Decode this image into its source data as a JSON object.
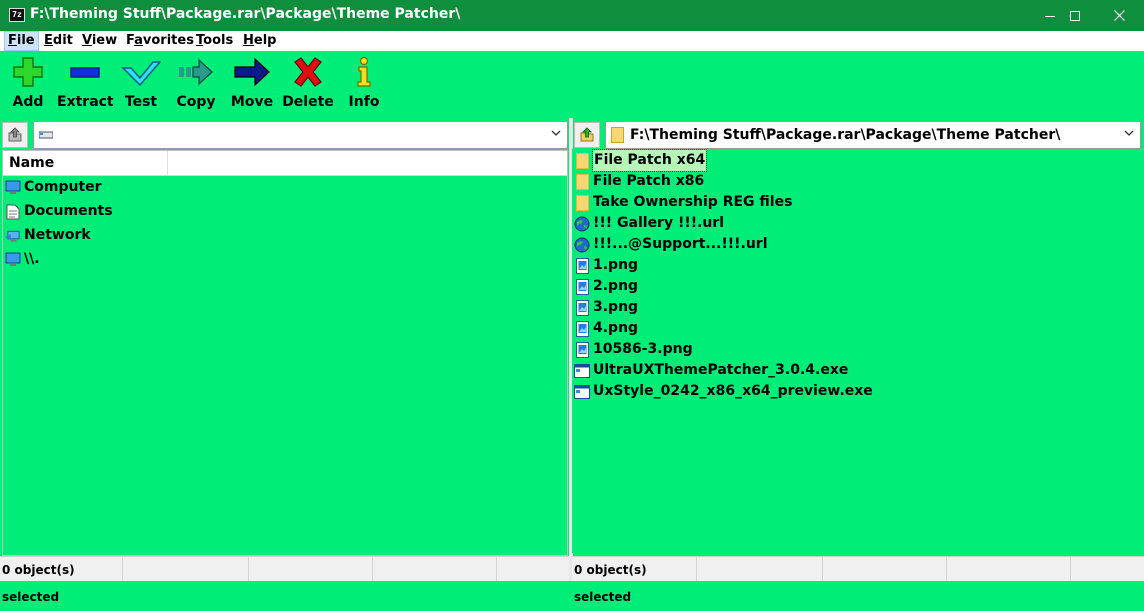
{
  "window": {
    "title": "F:\\Theming Stuff\\Package.rar\\Package\\Theme Patcher\\",
    "app_icon_text": "7z",
    "controls": {
      "minimize": "minimize-icon",
      "maximize": "maximize-icon",
      "close": "close-icon"
    }
  },
  "menu": {
    "items": [
      {
        "label": "File",
        "accel": "F"
      },
      {
        "label": "Edit",
        "accel": "E"
      },
      {
        "label": "View",
        "accel": "V"
      },
      {
        "label": "Favorites",
        "accel": "a"
      },
      {
        "label": "Tools",
        "accel": "T"
      },
      {
        "label": "Help",
        "accel": "H"
      }
    ]
  },
  "toolbar": {
    "items": [
      {
        "label": "Add",
        "icon": "plus-icon"
      },
      {
        "label": "Extract",
        "icon": "minus-icon"
      },
      {
        "label": "Test",
        "icon": "checkmark-icon"
      },
      {
        "label": "Copy",
        "icon": "copy-arrow-icon"
      },
      {
        "label": "Move",
        "icon": "move-arrow-icon"
      },
      {
        "label": "Delete",
        "icon": "x-icon"
      },
      {
        "label": "Info",
        "icon": "info-icon"
      }
    ]
  },
  "left_pane": {
    "address": "",
    "address_icon": "drive-icon",
    "column_name": "Name",
    "items": [
      {
        "label": "Computer",
        "icon": "computer-icon"
      },
      {
        "label": "Documents",
        "icon": "documents-icon"
      },
      {
        "label": "Network",
        "icon": "network-icon"
      },
      {
        "label": "\\\\.",
        "icon": "computer-icon"
      }
    ],
    "status": "0 object(s) selected"
  },
  "right_pane": {
    "address": "F:\\Theming Stuff\\Package.rar\\Package\\Theme Patcher\\",
    "address_icon": "folder-icon",
    "items": [
      {
        "label": "File Patch x64",
        "icon": "folder-icon",
        "selected": true
      },
      {
        "label": "File Patch x86",
        "icon": "folder-icon"
      },
      {
        "label": "Take Ownership REG files",
        "icon": "folder-icon"
      },
      {
        "label": "!!! Gallery !!!.url",
        "icon": "globe-icon"
      },
      {
        "label": "!!!...@Support...!!!.url",
        "icon": "globe-icon"
      },
      {
        "label": "1.png",
        "icon": "image-file-icon"
      },
      {
        "label": "2.png",
        "icon": "image-file-icon"
      },
      {
        "label": "3.png",
        "icon": "image-file-icon"
      },
      {
        "label": "4.png",
        "icon": "image-file-icon"
      },
      {
        "label": "10586-3.png",
        "icon": "image-file-icon"
      },
      {
        "label": "UltraUXThemePatcher_3.0.4.exe",
        "icon": "exe-file-icon"
      },
      {
        "label": "UxStyle_0242_x86_x64_preview.exe",
        "icon": "exe-file-icon"
      }
    ],
    "status": "0 object(s) selected"
  },
  "colors": {
    "titlebar": "#0f8f3e",
    "pane_background": "#00ee77",
    "selection": "#b5f5b8"
  }
}
